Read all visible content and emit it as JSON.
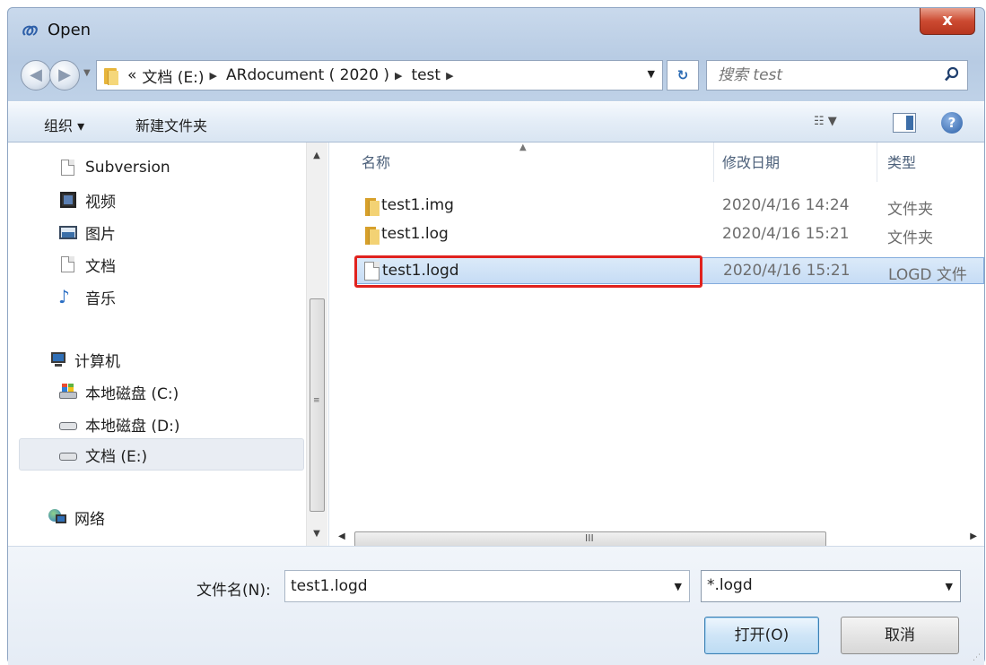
{
  "window": {
    "title": "Open",
    "close_label": "x"
  },
  "address": {
    "overflow": "«",
    "segments": [
      "文档 (E:)",
      "ARdocument ( 2020 )",
      "test"
    ],
    "search_placeholder": "搜索 test"
  },
  "toolbar": {
    "organize_label": "组织 ▾",
    "new_folder_label": "新建文件夹"
  },
  "nav": {
    "items": [
      {
        "label": "Subversion",
        "icon": "document-icon"
      },
      {
        "label": "视频",
        "icon": "video-icon"
      },
      {
        "label": "图片",
        "icon": "picture-icon"
      },
      {
        "label": "文档",
        "icon": "document-icon"
      },
      {
        "label": "音乐",
        "icon": "music-icon"
      },
      {
        "label": "计算机",
        "icon": "computer-icon"
      },
      {
        "label": "本地磁盘 (C:)",
        "icon": "drive-icon"
      },
      {
        "label": "本地磁盘 (D:)",
        "icon": "drive-icon"
      },
      {
        "label": "文档 (E:)",
        "icon": "drive-icon",
        "selected": true
      },
      {
        "label": "网络",
        "icon": "network-icon"
      }
    ]
  },
  "files": {
    "columns": [
      "名称",
      "修改日期",
      "类型"
    ],
    "rows": [
      {
        "name": "test1.img",
        "date": "2020/4/16 14:24",
        "type": "文件夹",
        "icon": "folder-icon"
      },
      {
        "name": "test1.log",
        "date": "2020/4/16 15:21",
        "type": "文件夹",
        "icon": "folder-icon"
      },
      {
        "name": "test1.logd",
        "date": "2020/4/16 15:21",
        "type": "LOGD 文件",
        "icon": "file-icon",
        "selected": true
      }
    ],
    "hscroll_grip": "III",
    "vscroll_grip": "≡"
  },
  "footer": {
    "filename_label": "文件名(N):",
    "filename_value": "test1.logd",
    "filetype_value": "*.logd",
    "open_label": "打开(O)",
    "cancel_label": "取消"
  },
  "colors": {
    "highlight": "#e0221e",
    "selection": "#cfe3f7"
  }
}
